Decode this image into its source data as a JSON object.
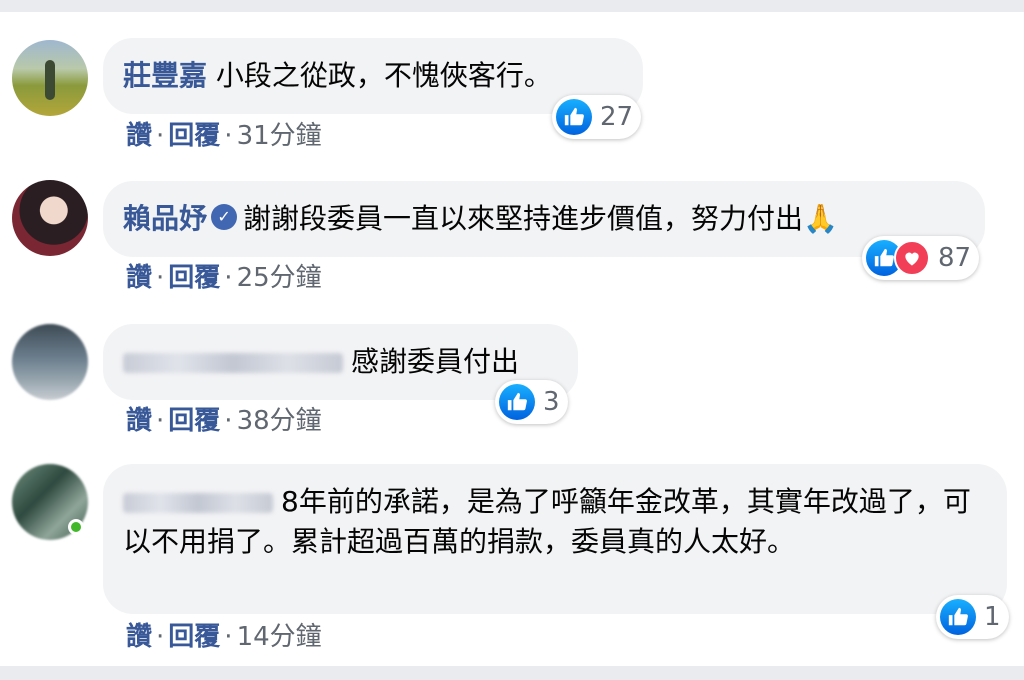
{
  "actions": {
    "like": "讚",
    "reply": "回覆",
    "separator": "·"
  },
  "comments": [
    {
      "author": "莊豐嘉",
      "text": "小段之從政，不愧俠客行。",
      "time": "31分鐘",
      "reaction_count": "27",
      "reactions": [
        "like"
      ]
    },
    {
      "author": "賴品妤",
      "verified": true,
      "text": "謝謝段委員一直以來堅持進步價值，努力付出🙏",
      "time": "25分鐘",
      "reaction_count": "87",
      "reactions": [
        "like",
        "love"
      ]
    },
    {
      "author": "",
      "author_blurred": true,
      "text": "感謝委員付出",
      "time": "38分鐘",
      "reaction_count": "3",
      "reactions": [
        "like"
      ]
    },
    {
      "author": "",
      "author_blurred": true,
      "author_online": true,
      "text": "8年前的承諾，是為了呼籲年金改革，其實年改過了，可以不用捐了。累計超過百萬的捐款，委員真的人太好。",
      "time": "14分鐘",
      "reaction_count": "1",
      "reactions": [
        "like"
      ]
    }
  ],
  "colors": {
    "name": "#385898",
    "bubble": "#f2f3f5",
    "like_blue": "#1877f2",
    "love_red": "#f33e58",
    "online_green": "#42b72a"
  }
}
